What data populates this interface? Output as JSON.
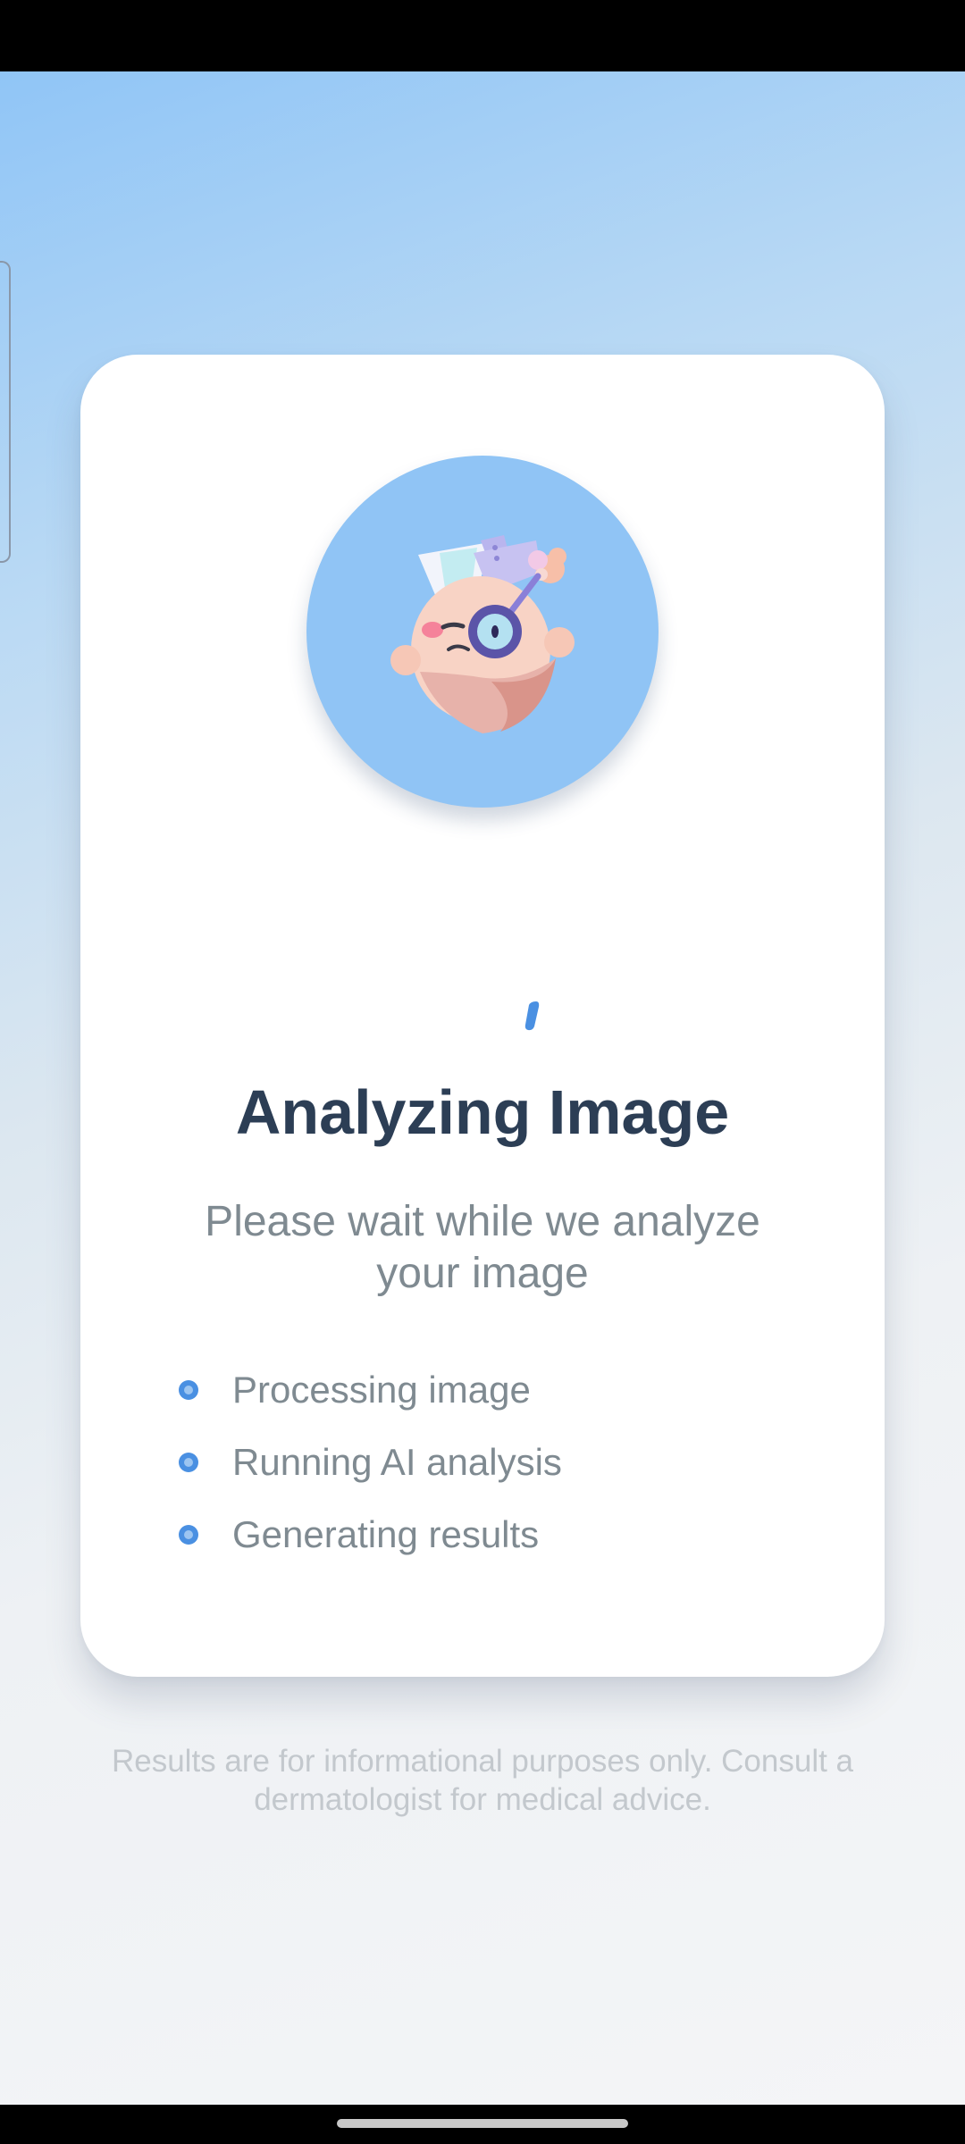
{
  "loading": {
    "title": "Analyzing Image",
    "subtitle": "Please wait while we analyze your image",
    "steps": [
      {
        "label": "Processing image"
      },
      {
        "label": "Running AI analysis"
      },
      {
        "label": "Generating results"
      }
    ]
  },
  "disclaimer": "Results are for informational purposes only. Consult a dermatologist for medical advice.",
  "icons": {
    "illustration": "dermatologist-avatar-icon",
    "spinner": "loading-spinner-icon",
    "step_bullet": "bullet-dot-icon"
  },
  "colors": {
    "accent": "#4a90e2",
    "avatar_bg": "#90c4f5",
    "title": "#2c3e55",
    "muted_text": "#7f8a91",
    "disclaimer_text": "#c3c8cd"
  }
}
